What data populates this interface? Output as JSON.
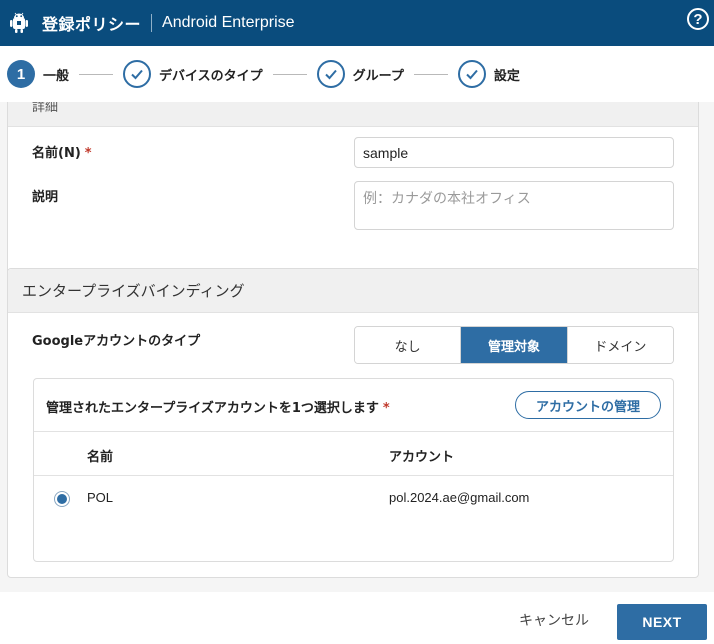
{
  "header": {
    "title": "登録ポリシー",
    "subtitle": "Android Enterprise",
    "help_symbol": "?"
  },
  "stepper": {
    "steps": [
      {
        "number": "1",
        "label": "一般",
        "state": "active"
      },
      {
        "label": "デバイスのタイプ",
        "state": "done"
      },
      {
        "label": "グループ",
        "state": "done"
      },
      {
        "label": "設定",
        "state": "done"
      }
    ]
  },
  "details": {
    "section_title_partial": "詳細",
    "name_label": "名前(N)",
    "required_mark": "*",
    "name_value": "sample",
    "description_label": "説明",
    "description_placeholder": "例：カナダの本社オフィス"
  },
  "binding": {
    "section_title": "エンタープライズバインディング",
    "account_type_label": "Googleアカウントのタイプ",
    "account_type_options": [
      "なし",
      "管理対象",
      "ドメイン"
    ],
    "account_type_selected": "管理対象",
    "select_title": "管理されたエンタープライズアカウントを1つ選択します",
    "required_mark": "*",
    "manage_button": "アカウントの管理",
    "table": {
      "columns": [
        "名前",
        "アカウント"
      ],
      "rows": [
        {
          "selected": true,
          "name": "POL",
          "account": "pol.2024.ae@gmail.com"
        }
      ]
    }
  },
  "footer": {
    "cancel_label": "キャンセル",
    "next_label": "NEXT"
  },
  "colors": {
    "header_bg": "#0a4c7d",
    "accent": "#2e6da4",
    "required": "#c0392b"
  }
}
